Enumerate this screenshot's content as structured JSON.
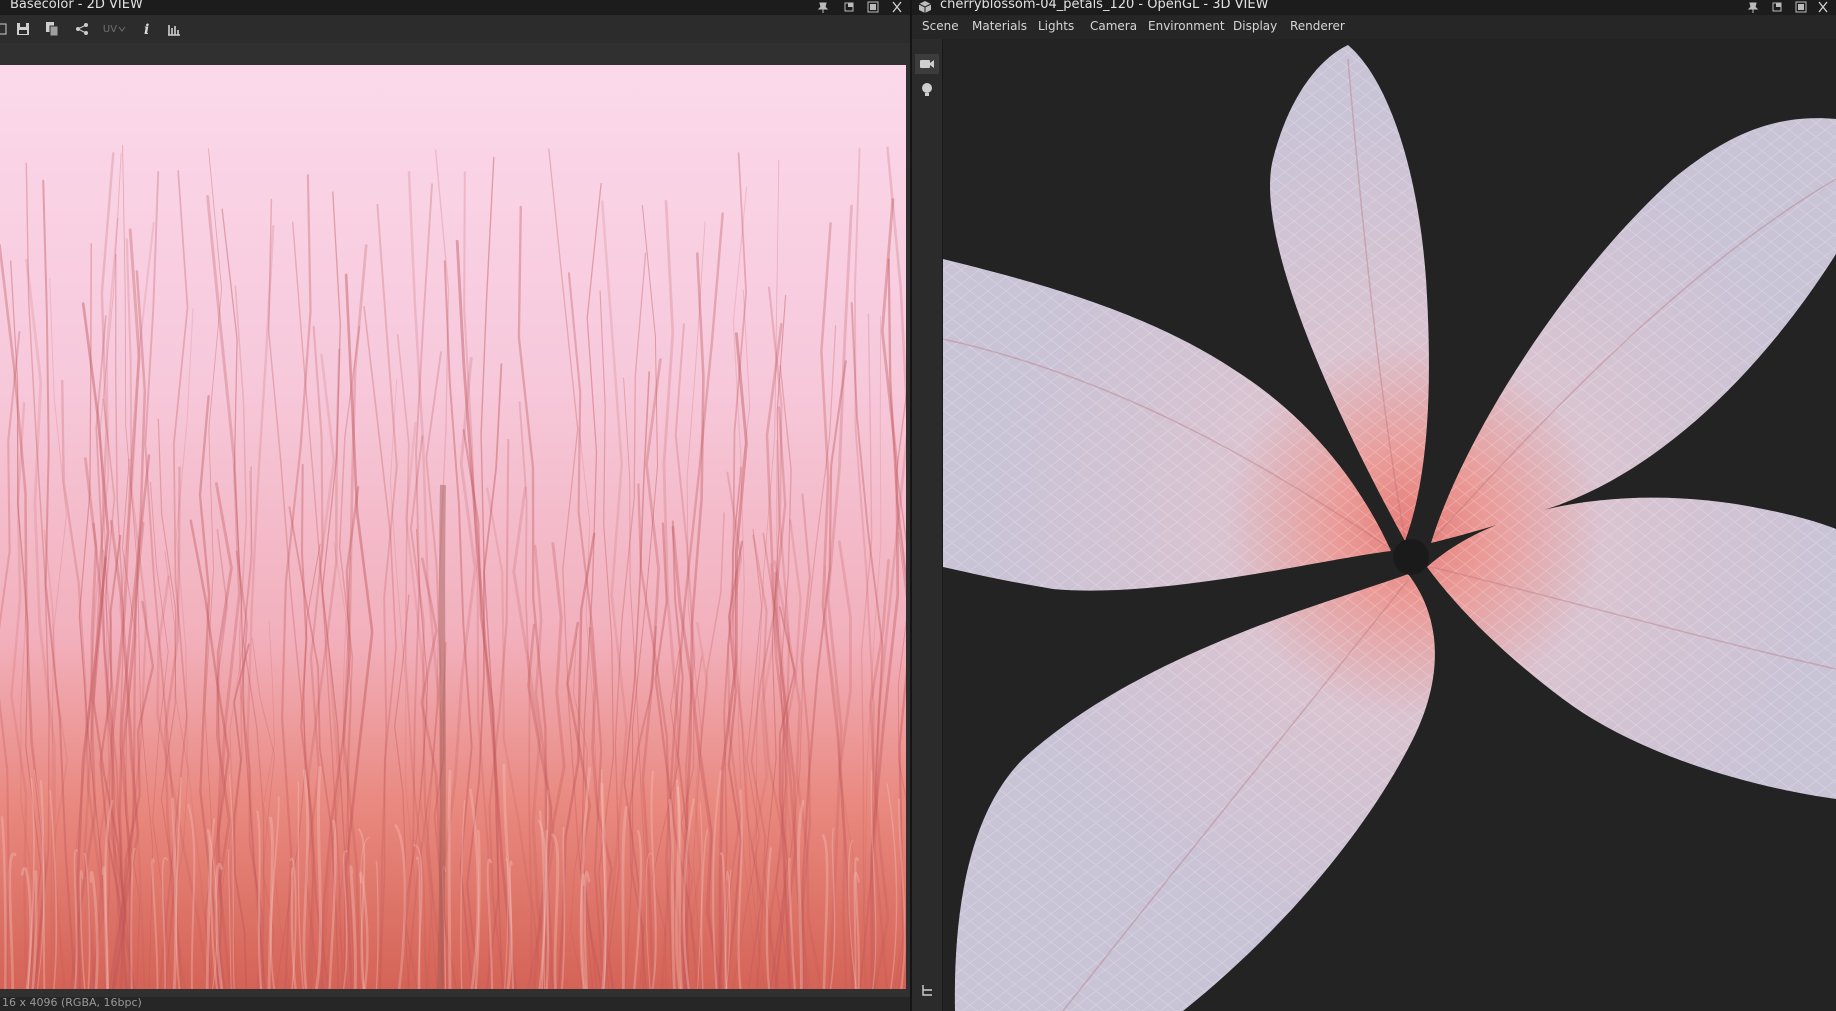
{
  "left_panel": {
    "title": "Basecolor - 2D VIEW",
    "toolbar": {
      "uv_label": "UV"
    },
    "status": "16 x 4096 (RGBA, 16bpc)"
  },
  "right_panel": {
    "title": "cherryblossom-04_petals_120 - OpenGL - 3D VIEW",
    "menu": [
      {
        "label": "Scene"
      },
      {
        "label": "Materials"
      },
      {
        "label": "Lights"
      },
      {
        "label": "Camera"
      },
      {
        "label": "Environment"
      },
      {
        "label": "Display"
      },
      {
        "label": "Renderer"
      }
    ]
  },
  "colors": {
    "texture_top": "#fbd9eb",
    "texture_mid": "#f2b6c4",
    "texture_bottom": "#d46356",
    "vein": "#c0575a",
    "petal_tip": "#c9c3d6",
    "petal_base": "#e67d78",
    "panel_bg": "#232323",
    "title_bar": "#1c1c1c"
  }
}
